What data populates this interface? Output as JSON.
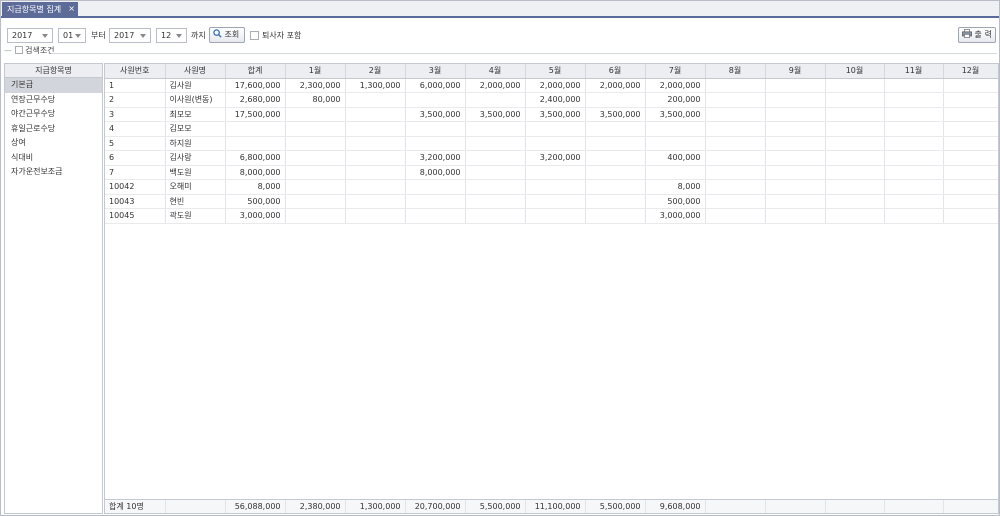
{
  "tab": {
    "title": "지급항목별 집계",
    "close": "×"
  },
  "toolbar": {
    "from_year": "2017",
    "from_month": "01",
    "from_label": "부터",
    "to_year": "2017",
    "to_month": "12",
    "to_label": "까지",
    "search_label": "조회",
    "retired_label": "퇴사자 포함",
    "print_label": "출 력"
  },
  "condition_label": "검색조건",
  "left": {
    "header": "지급항목명",
    "items": [
      "기본급",
      "연장근무수당",
      "야간근무수당",
      "휴일근로수당",
      "상여",
      "식대비",
      "자가운전보조금"
    ]
  },
  "grid": {
    "headers": [
      "사원번호",
      "사원명",
      "합계",
      "1월",
      "2월",
      "3월",
      "4월",
      "5월",
      "6월",
      "7월",
      "8월",
      "9월",
      "10월",
      "11월",
      "12월"
    ],
    "rows": [
      [
        "1",
        "김사원",
        "17,600,000",
        "2,300,000",
        "1,300,000",
        "6,000,000",
        "2,000,000",
        "2,000,000",
        "2,000,000",
        "2,000,000",
        "",
        "",
        "",
        "",
        ""
      ],
      [
        "2",
        "이사원(변동)",
        "2,680,000",
        "80,000",
        "",
        "",
        "",
        "2,400,000",
        "",
        "200,000",
        "",
        "",
        "",
        "",
        ""
      ],
      [
        "3",
        "최모모",
        "17,500,000",
        "",
        "",
        "3,500,000",
        "3,500,000",
        "3,500,000",
        "3,500,000",
        "3,500,000",
        "",
        "",
        "",
        "",
        ""
      ],
      [
        "4",
        "김모모",
        "",
        "",
        "",
        "",
        "",
        "",
        "",
        "",
        "",
        "",
        "",
        "",
        ""
      ],
      [
        "5",
        "하지원",
        "",
        "",
        "",
        "",
        "",
        "",
        "",
        "",
        "",
        "",
        "",
        "",
        ""
      ],
      [
        "6",
        "김사랑",
        "6,800,000",
        "",
        "",
        "3,200,000",
        "",
        "3,200,000",
        "",
        "400,000",
        "",
        "",
        "",
        "",
        ""
      ],
      [
        "7",
        "백도원",
        "8,000,000",
        "",
        "",
        "8,000,000",
        "",
        "",
        "",
        "",
        "",
        "",
        "",
        "",
        ""
      ],
      [
        "10042",
        "오해미",
        "8,000",
        "",
        "",
        "",
        "",
        "",
        "",
        "8,000",
        "",
        "",
        "",
        "",
        ""
      ],
      [
        "10043",
        "현빈",
        "500,000",
        "",
        "",
        "",
        "",
        "",
        "",
        "500,000",
        "",
        "",
        "",
        "",
        ""
      ],
      [
        "10045",
        "곽도원",
        "3,000,000",
        "",
        "",
        "",
        "",
        "",
        "",
        "3,000,000",
        "",
        "",
        "",
        "",
        ""
      ]
    ],
    "footer": [
      "합계  10명",
      "",
      "56,088,000",
      "2,380,000",
      "1,300,000",
      "20,700,000",
      "5,500,000",
      "11,100,000",
      "5,500,000",
      "9,608,000",
      "",
      "",
      "",
      "",
      ""
    ]
  }
}
